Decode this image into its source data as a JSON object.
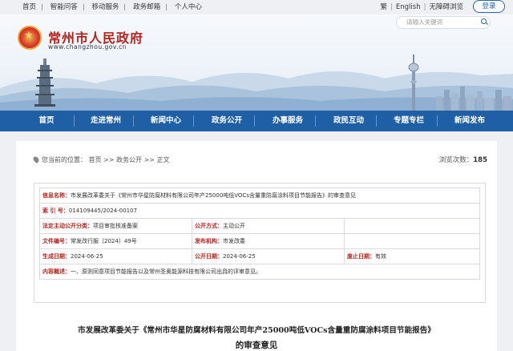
{
  "top_links": [
    "首页",
    "智能问答",
    "移动服务",
    "政务邮箱",
    "个人中心"
  ],
  "toolbar": {
    "lang_trad": "繁",
    "lang_en": "English",
    "accessibility": "无障碍浏览",
    "login": "登录"
  },
  "search": {
    "placeholder": "请输入关键词"
  },
  "header": {
    "title": "常州市人民政府",
    "domain": "www.changzhou.gov.cn"
  },
  "nav": [
    "首页",
    "走进常州",
    "新闻中心",
    "政务公开",
    "办事服务",
    "政民互动",
    "专题专栏",
    "新闻发布"
  ],
  "breadcrumb": {
    "prefix": "您当前的位置：",
    "items": [
      "首页",
      "政务公开",
      "正文"
    ],
    "sep": ">>"
  },
  "views": {
    "label": "浏览次数：",
    "count": "185"
  },
  "meta": {
    "info_name_label": "信息名称：",
    "info_name": "市发展改革委关于《常州市华星防腐材料有限公司年产25000吨低VOCs含量重防腐涂料项目节能报告》的审查意见",
    "index_label": "索 引 号：",
    "index": "014109445/2024-00107",
    "category_label": "法定主动公开分类：",
    "category": "项目审批核准备案",
    "public_method_label": "公开方式：",
    "public_method": "主动公开",
    "doc_no_label": "文件编号：",
    "doc_no": "常发改行服〔2024〕49号",
    "publisher_label": "发布机构：",
    "publisher": "市发改委",
    "generated_label": "生成日期：",
    "generated": "2024-06-25",
    "public_date_label": "公开日期：",
    "public_date": "2024-06-25",
    "expiry_label": "废止日期：",
    "expiry": "有效",
    "summary_label": "内容概述：",
    "summary": "一、原则同意项目节能报告以及常州圣奥能源科技有限公司出具的评审意见。"
  },
  "doc": {
    "title_line1": "市发展改革委关于《常州市华星防腐材料有限公司年产25000吨低VOCs含量重防腐涂料项目节能报告》",
    "title_line2": "的审查意见"
  },
  "colors": {
    "brand_red": "#b7231c",
    "nav_blue": "#1f5fa6",
    "accent_blue": "#2c64a8"
  }
}
